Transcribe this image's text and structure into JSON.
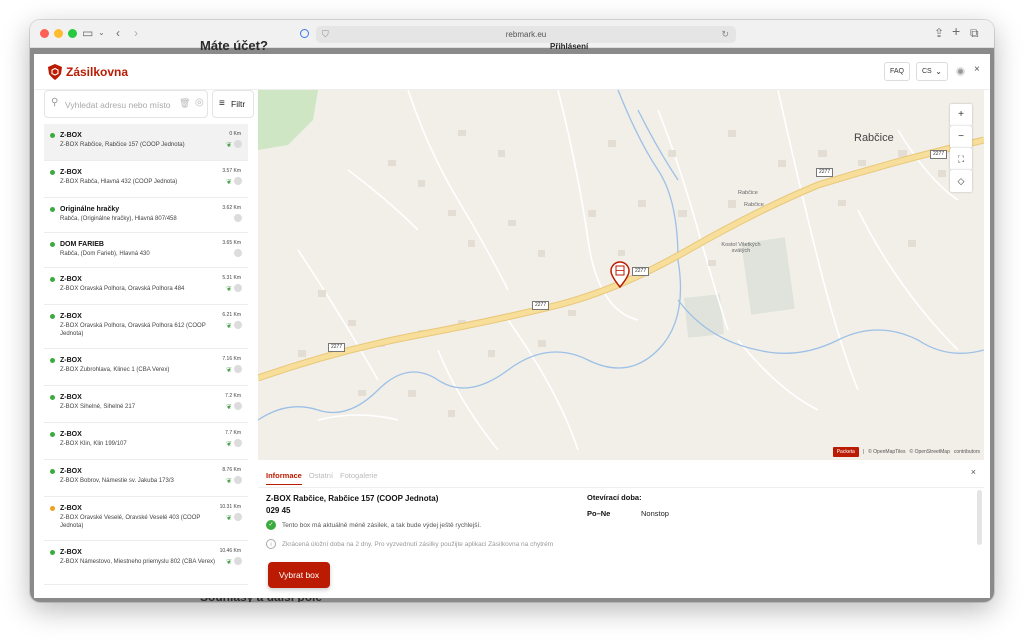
{
  "browser": {
    "url": "rebmark.eu"
  },
  "background_page": {
    "heading_top": "Máte účet?",
    "login_button": "Přihlásení",
    "heading_bottom": "Souhlasy a další pole"
  },
  "header": {
    "brand": "Zásilkovna",
    "faq_label": "FAQ",
    "language": "CS"
  },
  "search": {
    "placeholder": "Vyhledat adresu nebo místo",
    "filter_label": "Filtr"
  },
  "colors": {
    "brand": "#ba1b02",
    "status_green": "#3cab3e",
    "status_orange": "#f0a01e"
  },
  "list_items": [
    {
      "name": "Z-BOX",
      "address": "Z-BOX Rabčice, Rabčice 157 (COOP Jednota)",
      "distance": "0 Km",
      "status": "green",
      "eco": true
    },
    {
      "name": "Z-BOX",
      "address": "Z-BOX Rabča, Hlavná 432 (COOP Jednota)",
      "distance": "3.57 Km",
      "status": "green",
      "eco": true
    },
    {
      "name": "Originálne hračky",
      "address": "Rabča, (Originálne hračky), Hlavná 807/458",
      "distance": "3.62 Km",
      "status": "green",
      "eco": false
    },
    {
      "name": "DOM FARIEB",
      "address": "Rabča, (Dom Farieb), Hlavná 430",
      "distance": "3.65 Km",
      "status": "green",
      "eco": false
    },
    {
      "name": "Z-BOX",
      "address": "Z-BOX Oravská Polhora, Oravská Polhora 484",
      "distance": "5.31 Km",
      "status": "green",
      "eco": true
    },
    {
      "name": "Z-BOX",
      "address": "Z-BOX Oravská Polhora, Oravská Polhora 612 (COOP Jednota)",
      "distance": "6.21 Km",
      "status": "green",
      "eco": true
    },
    {
      "name": "Z-BOX",
      "address": "Z-BOX Zubrohlava, Klinec 1 (CBA Verex)",
      "distance": "7.16 Km",
      "status": "green",
      "eco": true
    },
    {
      "name": "Z-BOX",
      "address": "Z-BOX Sihelné, Sihelné 217",
      "distance": "7.2 Km",
      "status": "green",
      "eco": true
    },
    {
      "name": "Z-BOX",
      "address": "Z-BOX Klin, Klin 199/107",
      "distance": "7.7 Km",
      "status": "green",
      "eco": true
    },
    {
      "name": "Z-BOX",
      "address": "Z-BOX Bobrov, Námestie sv. Jakuba 173/3",
      "distance": "8.76 Km",
      "status": "green",
      "eco": true
    },
    {
      "name": "Z-BOX",
      "address": "Z-BOX Oravské Veselé, Oravské Veselé 403 (COOP Jednota)",
      "distance": "10.31 Km",
      "status": "orange",
      "eco": true
    },
    {
      "name": "Z-BOX",
      "address": "Z-BOX Námestovo, Miestneho priemyslu 802 (CBA Verex)",
      "distance": "10.46 Km",
      "status": "green",
      "eco": true
    }
  ],
  "map": {
    "town_label": "Rabčice",
    "poi_label_1": "Rabčice",
    "poi_label_2": "Rabčice",
    "church_label": "Kostol Všetkých svätých",
    "road_number": "2277",
    "attribution_brand": "Packeta",
    "attribution_tiles": "© OpenMapTiles",
    "attribution_osm": "© OpenStreetMap",
    "attribution_contrib": "contributors"
  },
  "detail": {
    "tabs": [
      "Informace",
      "Ostatní",
      "Fotogalerie"
    ],
    "title": "Z-BOX Rabčice, Rabčice 157 (COOP Jednota)",
    "zip": "029 45",
    "info_1": "Tento box má aktuálně méně zásilek, a tak bude výdej ještě rychlejší.",
    "info_2": "Zkrácená úložní doba na 2 dny. Pro vyzvednutí zásilky použijte aplikaci Zásilkovna na chytrém",
    "hours_title": "Otevírací doba:",
    "hours_day": "Po–Ne",
    "hours_value": "Nonstop",
    "select_button": "Vybrat box"
  }
}
